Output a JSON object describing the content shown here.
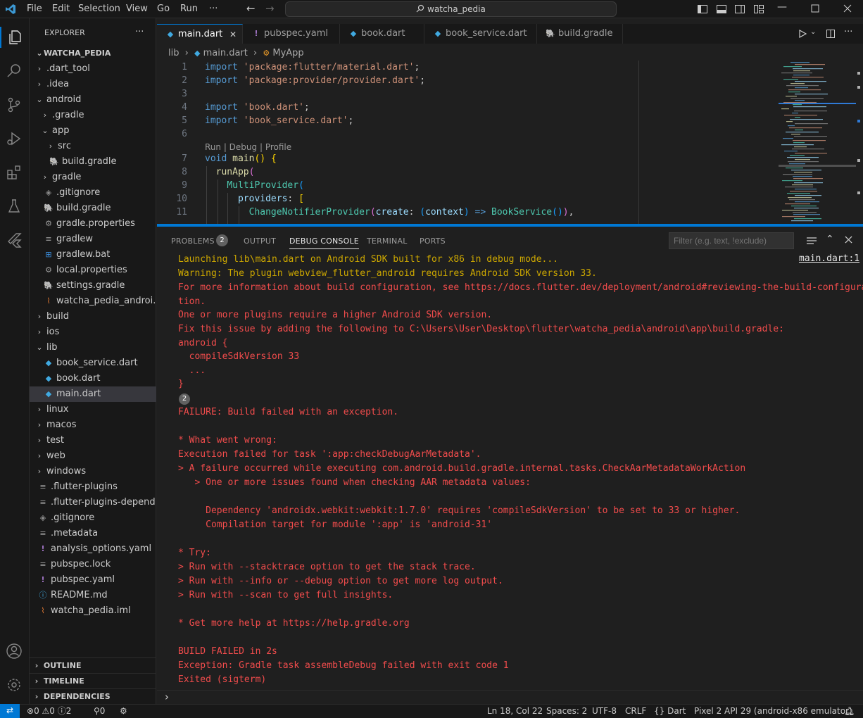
{
  "titlebar": {
    "menus": [
      "File",
      "Edit",
      "Selection",
      "View",
      "Go",
      "Run",
      "···"
    ],
    "search_text": "watcha_pedia"
  },
  "explorer": {
    "title": "EXPLORER",
    "more": "···",
    "project": "WATCHA_PEDIA",
    "items": [
      {
        "label": ".dart_tool",
        "depth": 1,
        "chev": "›",
        "icon": ""
      },
      {
        "label": ".idea",
        "depth": 1,
        "chev": "›",
        "icon": ""
      },
      {
        "label": "android",
        "depth": 1,
        "chev": "⌄",
        "icon": ""
      },
      {
        "label": ".gradle",
        "depth": 2,
        "chev": "›",
        "icon": ""
      },
      {
        "label": "app",
        "depth": 2,
        "chev": "⌄",
        "icon": ""
      },
      {
        "label": "src",
        "depth": 3,
        "chev": "›",
        "icon": ""
      },
      {
        "label": "build.gradle",
        "depth": 3,
        "chev": "",
        "icon": "gradle"
      },
      {
        "label": "gradle",
        "depth": 2,
        "chev": "›",
        "icon": ""
      },
      {
        "label": ".gitignore",
        "depth": 2,
        "chev": "",
        "icon": "git"
      },
      {
        "label": "build.gradle",
        "depth": 2,
        "chev": "",
        "icon": "gradle"
      },
      {
        "label": "gradle.properties",
        "depth": 2,
        "chev": "",
        "icon": "gear"
      },
      {
        "label": "gradlew",
        "depth": 2,
        "chev": "",
        "icon": "lines"
      },
      {
        "label": "gradlew.bat",
        "depth": 2,
        "chev": "",
        "icon": "win"
      },
      {
        "label": "local.properties",
        "depth": 2,
        "chev": "",
        "icon": "gear"
      },
      {
        "label": "settings.gradle",
        "depth": 2,
        "chev": "",
        "icon": "gradle"
      },
      {
        "label": "watcha_pedia_androi...",
        "depth": 2,
        "chev": "",
        "icon": "rss"
      },
      {
        "label": "build",
        "depth": 1,
        "chev": "›",
        "icon": ""
      },
      {
        "label": "ios",
        "depth": 1,
        "chev": "›",
        "icon": ""
      },
      {
        "label": "lib",
        "depth": 1,
        "chev": "⌄",
        "icon": ""
      },
      {
        "label": "book_service.dart",
        "depth": 2,
        "chev": "",
        "icon": "dart"
      },
      {
        "label": "book.dart",
        "depth": 2,
        "chev": "",
        "icon": "dart"
      },
      {
        "label": "main.dart",
        "depth": 2,
        "chev": "",
        "icon": "dart",
        "selected": true
      },
      {
        "label": "linux",
        "depth": 1,
        "chev": "›",
        "icon": ""
      },
      {
        "label": "macos",
        "depth": 1,
        "chev": "›",
        "icon": ""
      },
      {
        "label": "test",
        "depth": 1,
        "chev": "›",
        "icon": ""
      },
      {
        "label": "web",
        "depth": 1,
        "chev": "›",
        "icon": ""
      },
      {
        "label": "windows",
        "depth": 1,
        "chev": "›",
        "icon": ""
      },
      {
        "label": ".flutter-plugins",
        "depth": 1,
        "chev": "",
        "icon": "lines"
      },
      {
        "label": ".flutter-plugins-depend...",
        "depth": 1,
        "chev": "",
        "icon": "lines"
      },
      {
        "label": ".gitignore",
        "depth": 1,
        "chev": "",
        "icon": "git"
      },
      {
        "label": ".metadata",
        "depth": 1,
        "chev": "",
        "icon": "lines"
      },
      {
        "label": "analysis_options.yaml",
        "depth": 1,
        "chev": "",
        "icon": "yaml"
      },
      {
        "label": "pubspec.lock",
        "depth": 1,
        "chev": "",
        "icon": "lines"
      },
      {
        "label": "pubspec.yaml",
        "depth": 1,
        "chev": "",
        "icon": "yaml"
      },
      {
        "label": "README.md",
        "depth": 1,
        "chev": "",
        "icon": "info"
      },
      {
        "label": "watcha_pedia.iml",
        "depth": 1,
        "chev": "",
        "icon": "rss"
      }
    ],
    "sections": [
      "OUTLINE",
      "TIMELINE",
      "DEPENDENCIES"
    ]
  },
  "tabs": [
    {
      "label": "main.dart",
      "icon": "dart",
      "active": true,
      "close": "✕"
    },
    {
      "label": "pubspec.yaml",
      "icon": "yaml",
      "active": false
    },
    {
      "label": "book.dart",
      "icon": "dart",
      "active": false
    },
    {
      "label": "book_service.dart",
      "icon": "dart",
      "active": false
    },
    {
      "label": "build.gradle",
      "icon": "gradle",
      "active": false
    }
  ],
  "breadcrumb": {
    "part1": "lib",
    "part2": "main.dart",
    "part3": "MyApp"
  },
  "code": {
    "codelens": "Run | Debug | Profile",
    "line_numbers": [
      "1",
      "2",
      "3",
      "4",
      "5",
      "6",
      "7",
      "8",
      "9",
      "10",
      "11"
    ],
    "line1": "'package:flutter/material.dart'",
    "line2": "'package:provider/provider.dart'",
    "line4": "'book.dart'",
    "line5": "'book_service.dart'",
    "kw_import": "import",
    "kw_void": "void",
    "fn_main": "main",
    "fn_runapp": "runApp",
    "cls_multi": "MultiProvider",
    "var_providers": "providers",
    "cls_cnp": "ChangeNotifierProvider",
    "var_create": "create",
    "var_context": "context",
    "cls_bookservice": "BookService"
  },
  "panel": {
    "tabs": [
      "PROBLEMS",
      "OUTPUT",
      "DEBUG CONSOLE",
      "TERMINAL",
      "PORTS"
    ],
    "problems_count": "2",
    "active_tab": "DEBUG CONSOLE",
    "filter_placeholder": "Filter (e.g. text, !exclude)",
    "source_link": "main.dart:1",
    "group_count": "2",
    "lines": [
      "Launching lib\\main.dart on Android SDK built for x86 in debug mode...",
      "Warning: The plugin webview_flutter_android requires Android SDK version 33.",
      "For more information about build configuration, see https://docs.flutter.dev/deployment/android#reviewing-the-build-configura",
      "tion.",
      "One or more plugins require a higher Android SDK version.",
      "Fix this issue by adding the following to C:\\Users\\User\\Desktop\\flutter\\watcha_pedia\\android\\app\\build.gradle:",
      "android {",
      "  compileSdkVersion 33",
      "  ...",
      "}",
      "FAILURE: Build failed with an exception.",
      "* What went wrong:",
      "Execution failed for task ':app:checkDebugAarMetadata'.",
      "> A failure occurred while executing com.android.build.gradle.internal.tasks.CheckAarMetadataWorkAction",
      "   > One or more issues found when checking AAR metadata values:",
      "     Dependency 'androidx.webkit:webkit:1.7.0' requires 'compileSdkVersion' to be set to 33 or higher.",
      "     Compilation target for module ':app' is 'android-31'",
      "* Try:",
      "> Run with --stacktrace option to get the stack trace.",
      "> Run with --info or --debug option to get more log output.",
      "> Run with --scan to get full insights.",
      "* Get more help at https://help.gradle.org",
      "BUILD FAILED in 2s",
      "Exception: Gradle task assembleDebug failed with exit code 1",
      "Exited (sigterm)"
    ],
    "prompt": "›"
  },
  "status": {
    "errors": "0",
    "warnings": "0",
    "info": "2",
    "ports": "0",
    "position": "Ln 18, Col 22",
    "spaces": "Spaces: 2",
    "encoding": "UTF-8",
    "eol": "CRLF",
    "language": "Dart",
    "device": "Pixel 2 API 29 (android-x86 emulator)"
  },
  "colors": {
    "accent": "#0078d4",
    "error": "#f14c4c",
    "warning": "#cca700",
    "dart": "#40a9e0"
  }
}
